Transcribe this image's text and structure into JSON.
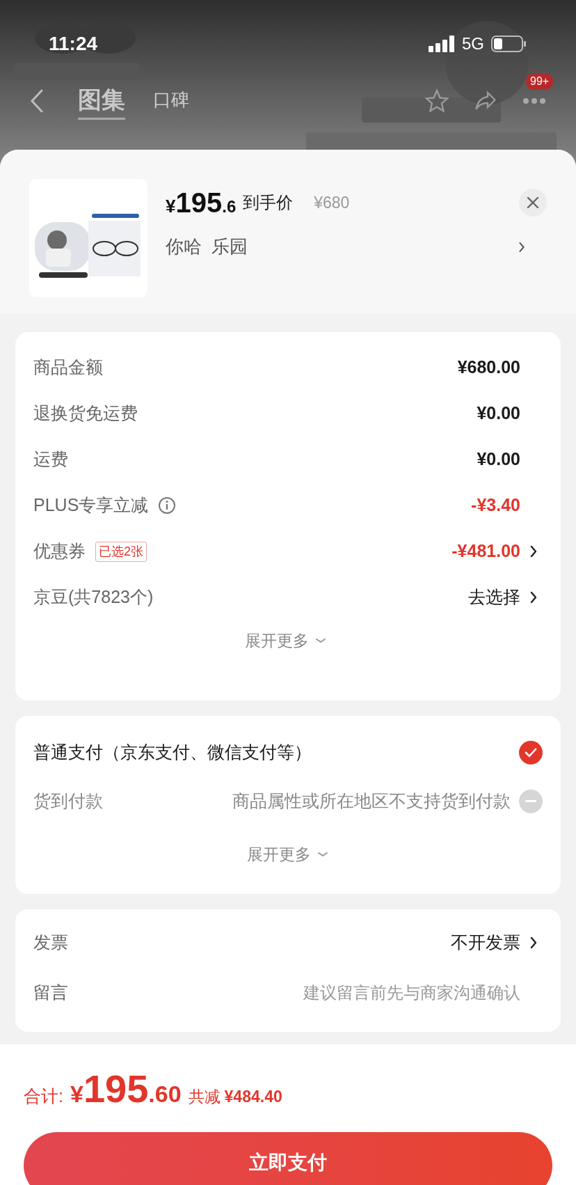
{
  "status_bar": {
    "time": "11:24",
    "network": "5G"
  },
  "nav": {
    "tabs": [
      {
        "label": "图集",
        "selected": true
      },
      {
        "label": "口碑",
        "selected": false
      }
    ],
    "badge": "99+"
  },
  "product": {
    "currency": "¥",
    "price_int": "195",
    "price_dec": ".6",
    "price_label": "到手价",
    "original_price": "¥680",
    "spec": [
      "你哈",
      "乐园"
    ]
  },
  "summary": {
    "rows": [
      {
        "label": "商品金额",
        "value": "¥680.00",
        "discount": false,
        "info": false,
        "chevron": false
      },
      {
        "label": "退换货免运费",
        "value": "¥0.00",
        "discount": false,
        "info": false,
        "chevron": false
      },
      {
        "label": "运费",
        "value": "¥0.00",
        "discount": false,
        "info": false,
        "chevron": false
      },
      {
        "label": "PLUS专享立减",
        "value": "-¥3.40",
        "discount": true,
        "info": true,
        "chevron": false
      },
      {
        "label": "优惠券",
        "tag": "已选2张",
        "value": "-¥481.00",
        "discount": true,
        "info": false,
        "chevron": true
      },
      {
        "label": "京豆(共7823个)",
        "value": "去选择",
        "discount": false,
        "info": false,
        "chevron": true
      }
    ],
    "expand": "展开更多"
  },
  "payment": {
    "options": [
      {
        "label": "普通支付（京东支付、微信支付等）",
        "selected": true,
        "disabled": false
      },
      {
        "label": "货到付款",
        "note": "商品属性或所在地区不支持货到付款",
        "selected": false,
        "disabled": true
      }
    ],
    "expand": "展开更多"
  },
  "extras": {
    "rows": [
      {
        "kind": "link",
        "label": "发票",
        "value": "不开发票"
      },
      {
        "kind": "input",
        "label": "留言",
        "placeholder": "建议留言前先与商家沟通确认"
      }
    ]
  },
  "footer": {
    "total_label": "合计:",
    "currency": "¥",
    "total_int": "195",
    "total_dec": ".60",
    "saved_label": "共减",
    "saved": "¥484.40",
    "pay_button": "立即支付"
  }
}
